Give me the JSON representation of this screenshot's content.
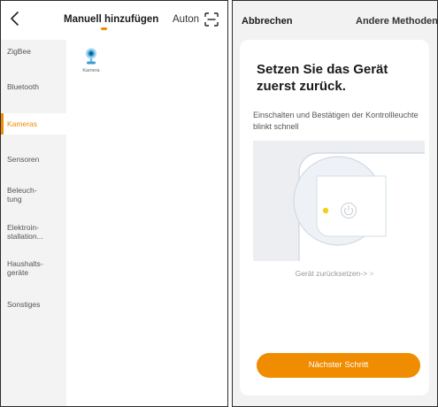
{
  "left_panel": {
    "header": {
      "active_tab": "Manuell hinzufügen",
      "auto_tab": "Auton",
      "icons": {
        "back": "chevron-left-icon",
        "scan": "scan-icon"
      }
    },
    "categories": [
      {
        "label": "ZigBee",
        "active": false
      },
      {
        "label": "Bluetooth",
        "active": false
      },
      {
        "label": "Kameras",
        "active": true
      },
      {
        "label": "Sensoren",
        "active": false
      },
      {
        "label_lines": [
          "Beleuch-",
          "tung"
        ],
        "active": false
      },
      {
        "label_lines": [
          "Elektroin-",
          "stallation..."
        ],
        "active": false
      },
      {
        "label_lines": [
          "Haushalts-",
          "geräte"
        ],
        "active": false
      },
      {
        "label": "Sonstiges",
        "active": false
      }
    ],
    "devices": [
      {
        "label": "Kamera",
        "icon": "camera-icon"
      }
    ]
  },
  "right_panel": {
    "cancel": "Abbrechen",
    "other_methods": "Andere Methoden",
    "card": {
      "title": "Setzen Sie das Gerät zuerst zurück.",
      "subtitle": "Einschalten und Bestätigen der Kontrollleuchte blinkt schnell",
      "illustration": "device-reset-illustration",
      "reset_link": "Gerät zurücksetzen->",
      "reset_arrow": ">",
      "next_button": "Nächster Schritt"
    }
  },
  "colors": {
    "accent": "#f08c00",
    "sidebar_bg": "#f3f3f3",
    "panel_bg": "#f2f2f2",
    "indicator_led": "#f2d11a"
  }
}
